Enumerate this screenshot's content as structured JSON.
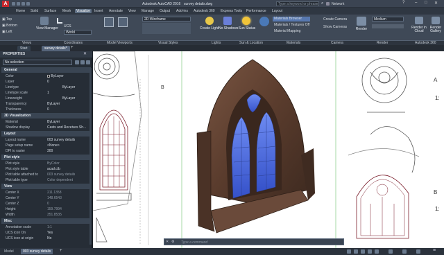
{
  "title_bar": {
    "app_title": "Autodesk AutoCAD 2016",
    "file": "survey details.dwg",
    "search_placeholder": "Type a keyword or phrase",
    "user": "Network"
  },
  "ribbon_tabs": [
    "Home",
    "Solid",
    "Surface",
    "Mesh",
    "Visualize",
    "Insert",
    "Annotate",
    "View",
    "Manage",
    "Output",
    "Add-ins",
    "Autodesk 360",
    "Express Tools",
    "Performance",
    "Layout"
  ],
  "active_tab": "Visualize",
  "ribbon": {
    "views": [
      "Top",
      "Bottom",
      "Left"
    ],
    "view_manager": "View Manager",
    "ucs": "UCS",
    "world": "World",
    "visual_style": "2D Wireframe",
    "create_light": "Create Light",
    "no_shadows": "No Shadows",
    "sun_status": "Sun Status",
    "materials_browser": "Materials Browser",
    "materials_textures": "Materials / Textures Off",
    "material_mapping": "Material Mapping",
    "create_camera": "Create Camera",
    "show_cameras": "Show Cameras",
    "render": "Render",
    "medium": "Medium",
    "render_in_cloud": "Render in Cloud",
    "render_gallery": "Render Gallery"
  },
  "panel_labels": [
    "Views",
    "Coordinates",
    "Model Viewports",
    "Visual Styles",
    "Lights",
    "Sun & Location",
    "Materials",
    "Camera",
    "Render",
    "Autodesk 360"
  ],
  "doc_tabs": [
    "Start",
    "survey details*"
  ],
  "active_doc": "survey details*",
  "properties": {
    "header": "PROPERTIES",
    "selection": "No selection",
    "sections": [
      {
        "title": "General",
        "rows": [
          [
            "Color",
            "ByLayer"
          ],
          [
            "Layer",
            "0"
          ],
          [
            "Linetype",
            "ByLayer"
          ],
          [
            "Linetype scale",
            "1"
          ],
          [
            "Lineweight",
            "ByLayer"
          ],
          [
            "Transparency",
            "ByLayer"
          ],
          [
            "Thickness",
            "0"
          ]
        ]
      },
      {
        "title": "3D Visualization",
        "rows": [
          [
            "Material",
            "ByLayer"
          ],
          [
            "Shadow display",
            "Casts and Receives Sh..."
          ]
        ]
      },
      {
        "title": "Layout",
        "rows": [
          [
            "Layout name",
            "003 survey details"
          ],
          [
            "Page setup name",
            "<None>"
          ],
          [
            "DPI to raster",
            "300"
          ]
        ]
      },
      {
        "title": "Plot style",
        "rows": [
          [
            "Plot style",
            "ByColor"
          ],
          [
            "Plot style table",
            "acad.ctb"
          ],
          [
            "Plot table attached to",
            "003 survey details"
          ],
          [
            "Plot table type",
            "Color dependent"
          ]
        ]
      },
      {
        "title": "View",
        "rows": [
          [
            "Center X",
            "211.1358"
          ],
          [
            "Center Y",
            "148.6543"
          ],
          [
            "Center Z",
            "0"
          ],
          [
            "Height",
            "159.7994"
          ],
          [
            "Width",
            "351.8535"
          ]
        ]
      },
      {
        "title": "Misc",
        "rows": [
          [
            "Annotation scale",
            "1:1"
          ],
          [
            "UCS icon On",
            "Yes"
          ],
          [
            "UCS icon at origin",
            "No"
          ]
        ]
      }
    ]
  },
  "canvas": {
    "left_letter": "B",
    "right_labels": [
      "A",
      "1:",
      "B",
      "1:"
    ],
    "command_placeholder": "Type a command"
  },
  "status": {
    "model_tab": "Model",
    "layout_tab": "003 survey details"
  },
  "colors": {
    "accent": "#5e6f84",
    "stone": "#5a3f30",
    "glass": "#4f6de0",
    "ui_dark": "#262d36"
  }
}
